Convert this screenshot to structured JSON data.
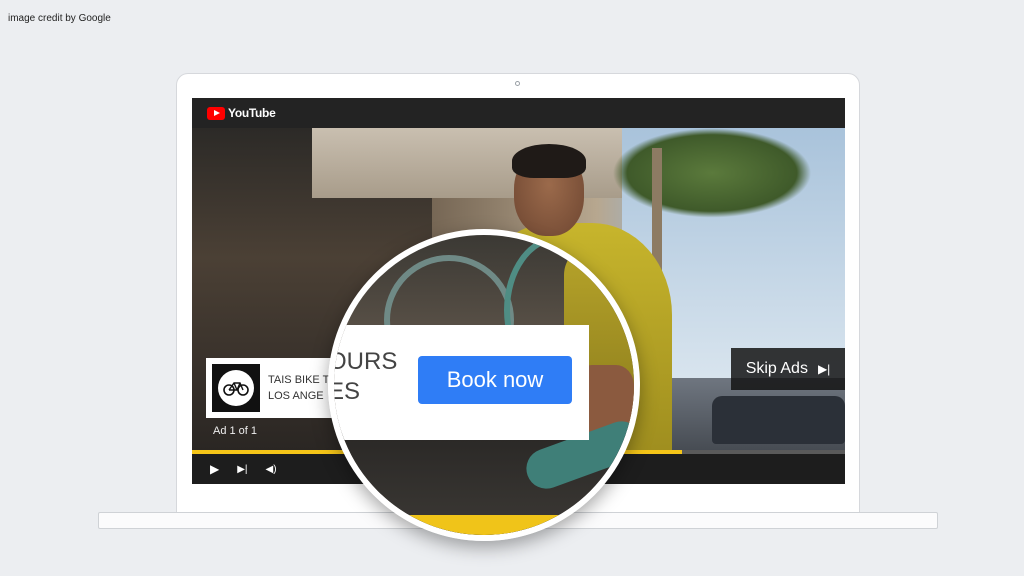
{
  "credit": "image credit by Google",
  "player": {
    "brand": "YouTube",
    "progress_fraction": 0.75,
    "controls": {
      "play_icon": "▶",
      "next_icon": "▶|",
      "volume_icon": "◀)"
    }
  },
  "ad": {
    "line1": "TAIS BIKE T",
    "line2": "LOS ANGE",
    "logo_icon": "bicycle-icon",
    "count": "Ad 1 of 1",
    "skip_label": "Skip Ads",
    "skip_icon": "▶|"
  },
  "magnified": {
    "text_line1": "OURS",
    "text_line2": "ES",
    "cta": "Book now"
  },
  "colors": {
    "accent_yellow": "#f5c518",
    "cta_blue": "#2f7df6",
    "youtube_red": "#ff0000"
  }
}
